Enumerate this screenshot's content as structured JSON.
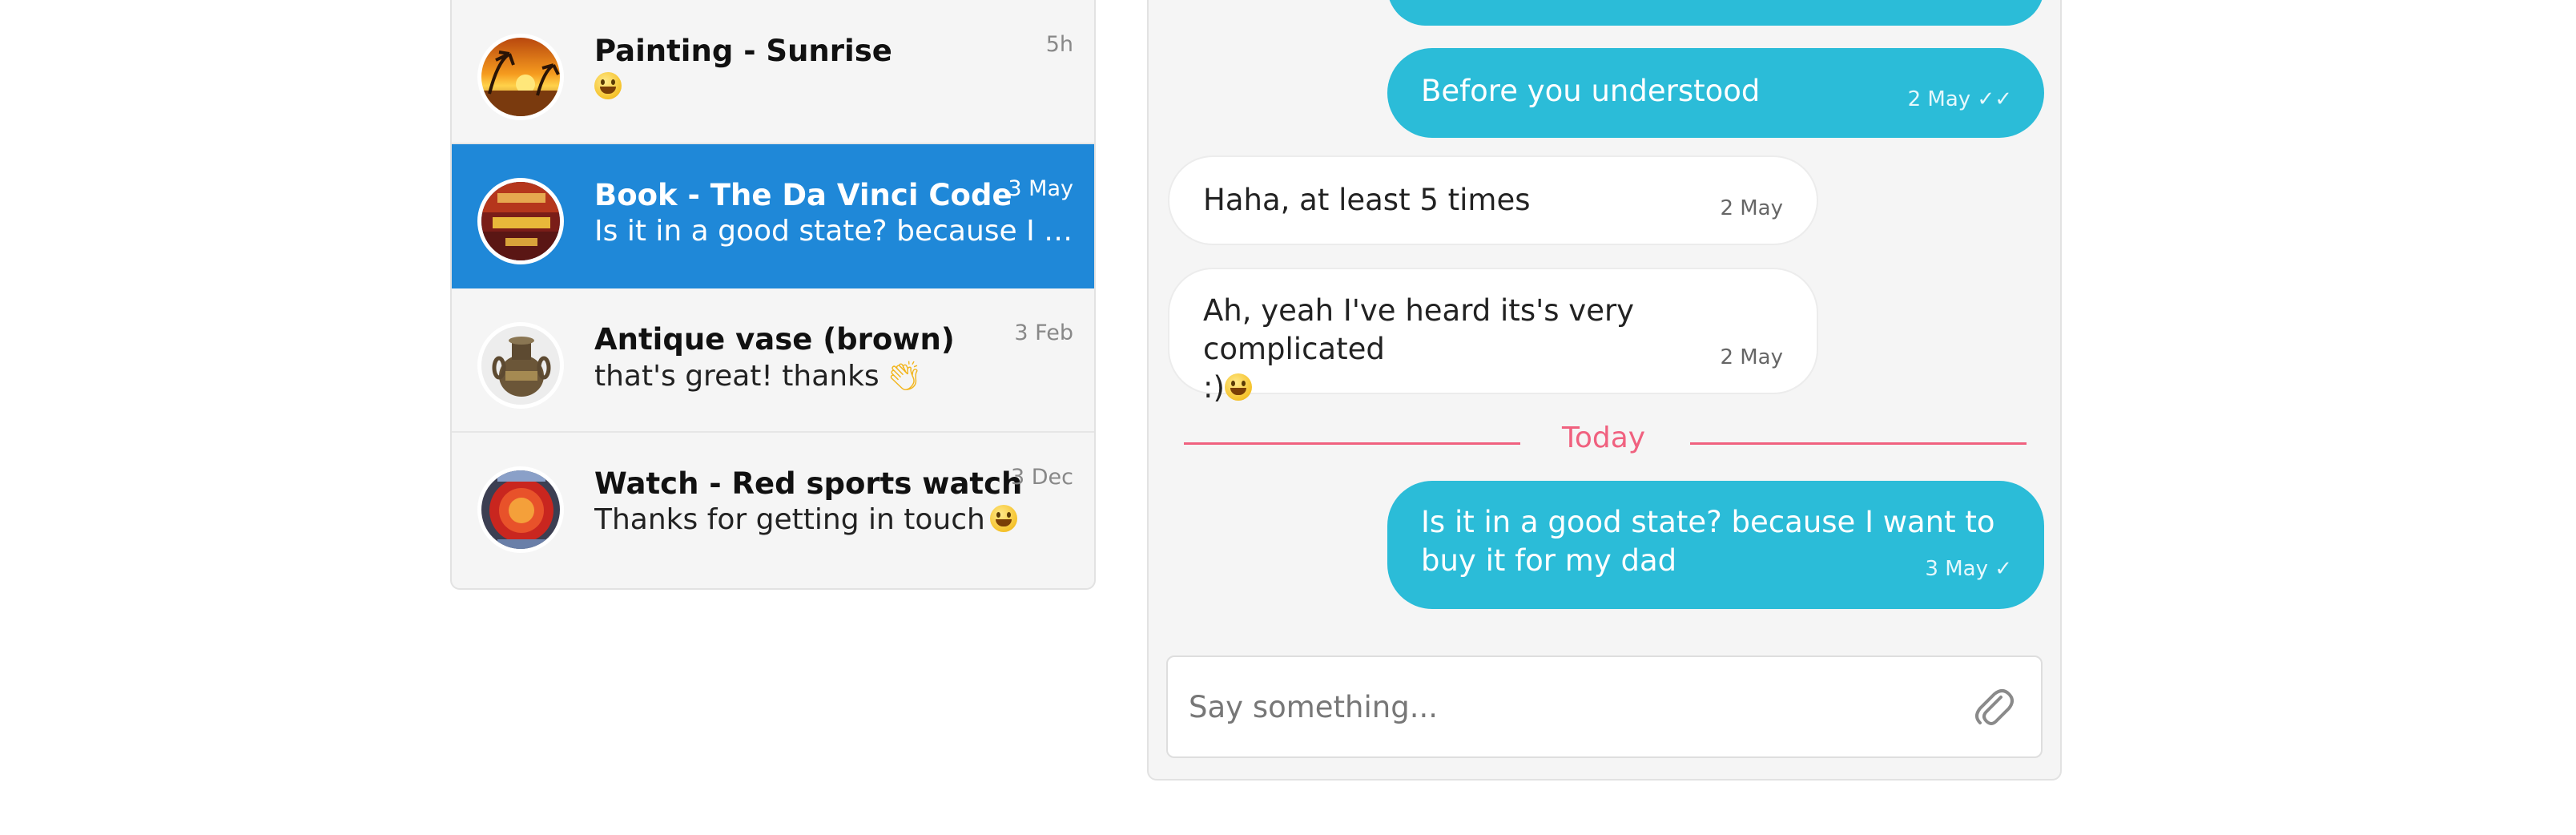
{
  "conversations": [
    {
      "title": "Painting - Sunrise",
      "preview": "",
      "emoji": "smile",
      "time": "5h",
      "active": false,
      "avatar": "sunset-painting"
    },
    {
      "title": "Book - The Da Vinci Code",
      "preview": "Is it in a good state? because I w...",
      "time": "3 May",
      "active": true,
      "avatar": "book-cover"
    },
    {
      "title": "Antique vase (brown)",
      "preview": "that's great! thanks",
      "emoji": "clapping-hands",
      "time": "3 Feb",
      "active": false,
      "avatar": "vase"
    },
    {
      "title": "Watch - Red sports watch",
      "preview": "Thanks for getting in touch",
      "emoji": "smile",
      "time": "3 Dec",
      "active": false,
      "avatar": "red-watch"
    }
  ],
  "messages": [
    {
      "direction": "out",
      "text": "",
      "meta": ""
    },
    {
      "direction": "out",
      "text": "Before you understood",
      "meta": "2 May ✓✓"
    },
    {
      "direction": "in",
      "text": "Haha, at least 5 times",
      "meta": "2 May"
    },
    {
      "direction": "in",
      "text": "Ah, yeah I've heard its's very complicated",
      "text2": ":)",
      "meta": "2 May"
    },
    {
      "direction": "out",
      "text": "Is it in a good state? because I want to",
      "text2": "buy it for my dad",
      "meta": "3 May ✓"
    }
  ],
  "divider": {
    "label": "Today"
  },
  "composer": {
    "placeholder": "Say something...",
    "attach_icon": "paperclip-icon"
  },
  "colors": {
    "accent_blue": "#1f88d8",
    "bubble_out": "#2bbcd8",
    "divider": "#f0617f"
  }
}
